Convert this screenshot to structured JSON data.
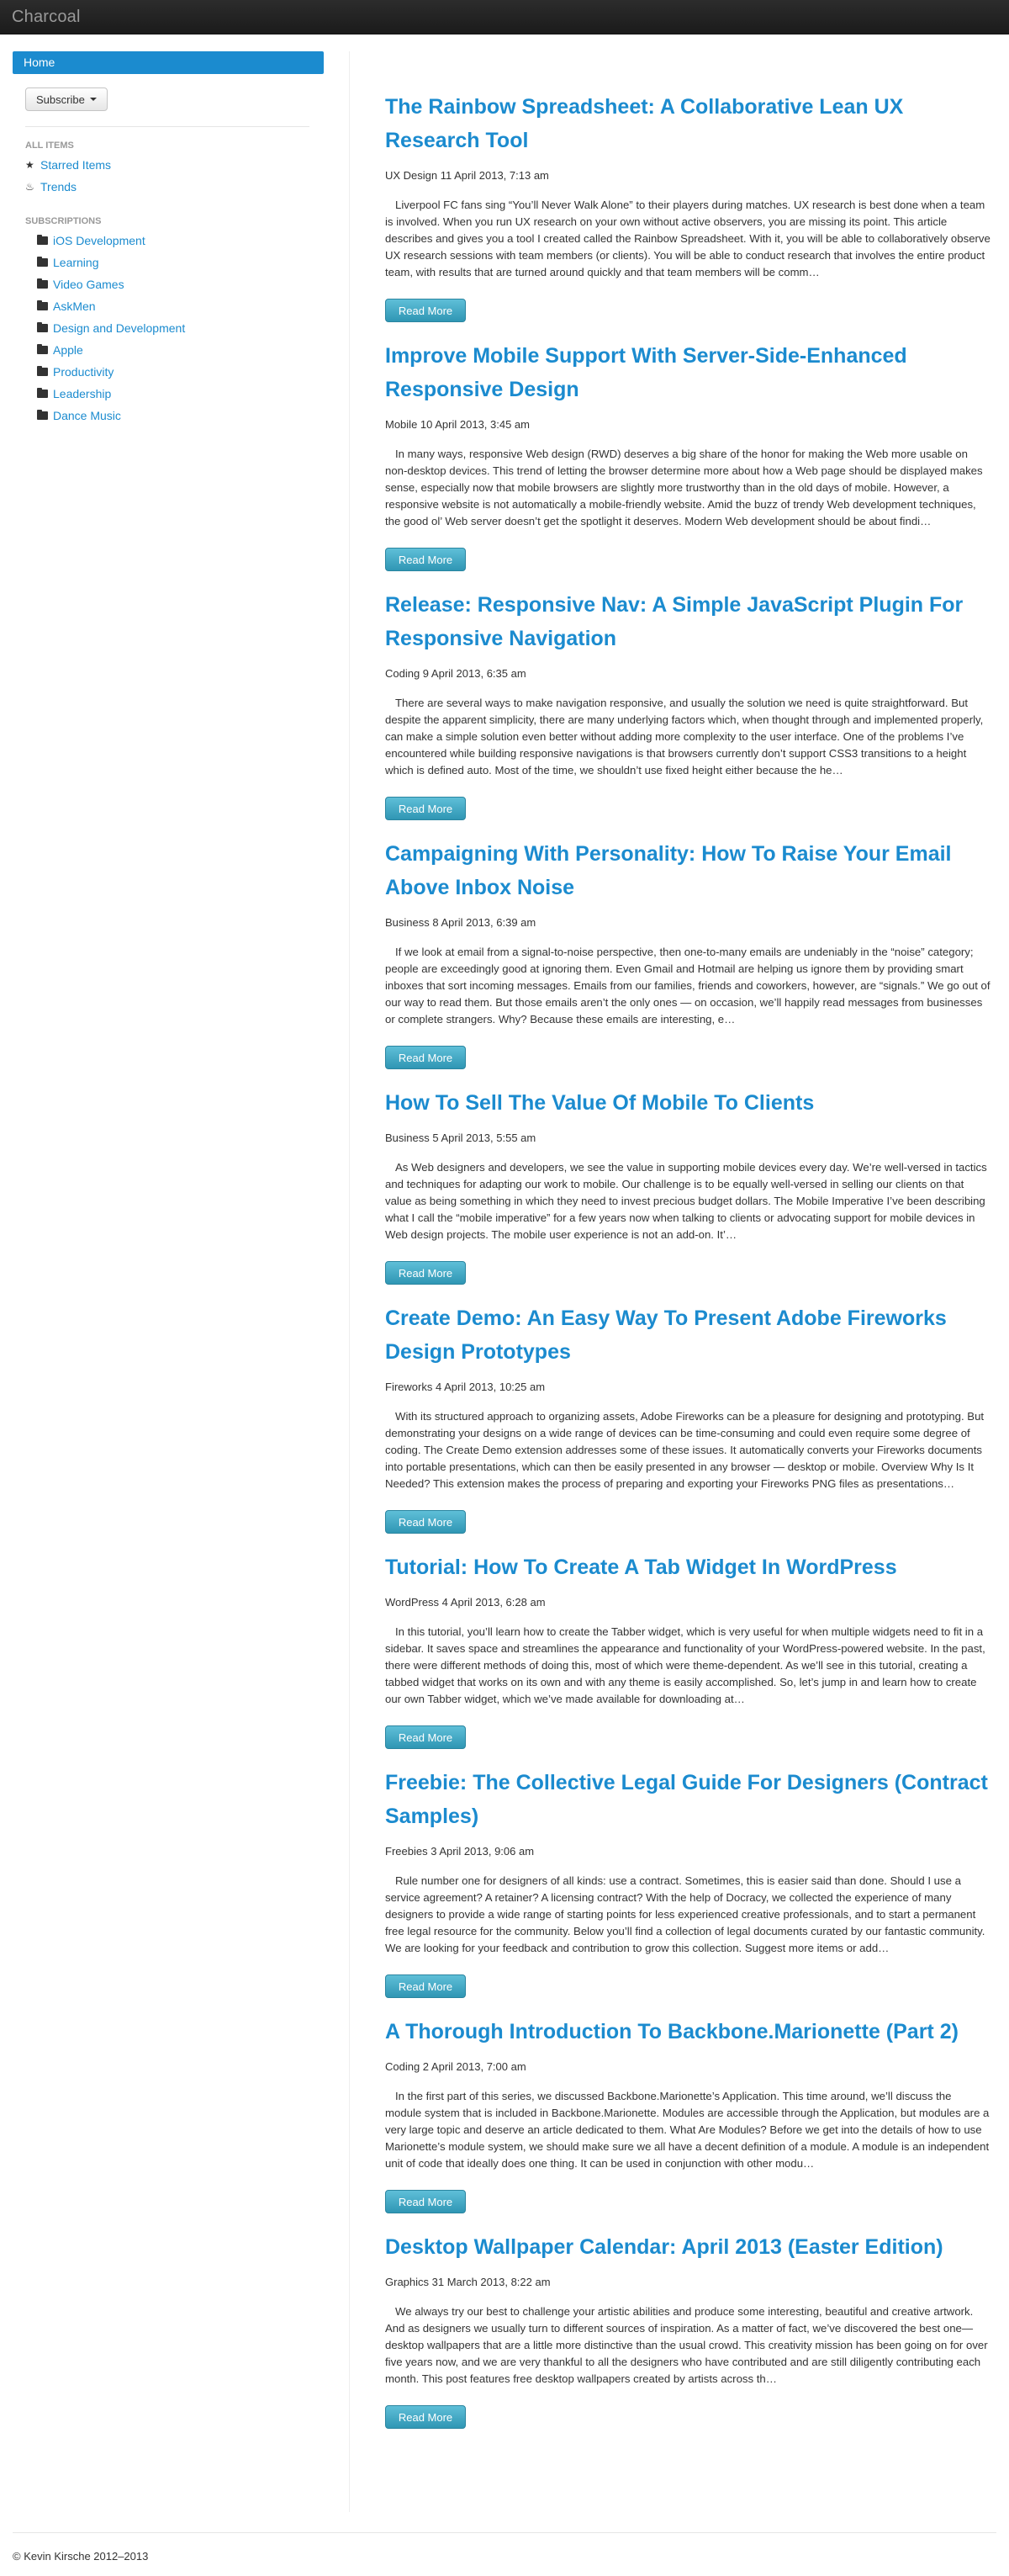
{
  "navbar": {
    "brand": "Charcoal"
  },
  "sidebar": {
    "home_label": "Home",
    "subscribe_label": "Subscribe",
    "all_items_header": "ALL ITEMS",
    "all_items": [
      {
        "label": "Starred Items",
        "icon": "star-icon"
      },
      {
        "label": "Trends",
        "icon": "fire-icon"
      }
    ],
    "subscriptions_header": "SUBSCRIPTIONS",
    "subscriptions": [
      "iOS Development",
      "Learning",
      "Video Games",
      "AskMen",
      "Design and Development",
      "Apple",
      "Productivity",
      "Leadership",
      "Dance Music"
    ]
  },
  "read_more_label": "Read More",
  "articles": [
    {
      "title": "The Rainbow Spreadsheet: A Collaborative Lean UX Research Tool",
      "meta": "UX Design 11 April 2013, 7:13 am",
      "excerpt": "Liverpool FC fans sing “You’ll Never Walk Alone” to their players during matches. UX research is best done when a team is involved. When you run UX research on your own without active observers, you are missing its point. This article describes and gives you a tool I created called the Rainbow Spreadsheet. With it, you will be able to collaboratively observe UX research sessions with team members (or clients). You will be able to conduct research that involves the entire product team, with results that are turned around quickly and that team members will be comm…"
    },
    {
      "title": "Improve Mobile Support With Server-Side-Enhanced Responsive Design",
      "meta": "Mobile 10 April 2013, 3:45 am",
      "excerpt": "In many ways, responsive Web design (RWD) deserves a big share of the honor for making the Web more usable on non-desktop devices. This trend of letting the browser determine more about how a Web page should be displayed makes sense, especially now that mobile browsers are slightly more trustworthy than in the old days of mobile. However, a responsive website is not automatically a mobile-friendly website. Amid the buzz of trendy Web development techniques, the good ol’ Web server doesn’t get the spotlight it deserves. Modern Web development should be about findi…"
    },
    {
      "title": "Release: Responsive Nav: A Simple JavaScript Plugin For Responsive Navigation",
      "meta": "Coding 9 April 2013, 6:35 am",
      "excerpt": "There are several ways to make navigation responsive, and usually the solution we need is quite straightforward. But despite the apparent simplicity, there are many underlying factors which, when thought through and implemented properly, can make a simple solution even better without adding more complexity to the user interface. One of the problems I’ve encountered while building responsive navigations is that browsers currently don’t support CSS3 transitions to a height which is defined auto. Most of the time, we shouldn’t use fixed height either because the he…"
    },
    {
      "title": "Campaigning With Personality: How To Raise Your Email Above Inbox Noise",
      "meta": "Business 8 April 2013, 6:39 am",
      "excerpt": "If we look at email from a signal-to-noise perspective, then one-to-many emails are undeniably in the “noise” category; people are exceedingly good at ignoring them. Even Gmail and Hotmail are helping us ignore them by providing smart inboxes that sort incoming messages. Emails from our families, friends and coworkers, however, are “signals.” We go out of our way to read them. But those emails aren’t the only ones — on occasion, we’ll happily read messages from businesses or complete strangers. Why? Because these emails are interesting, e…"
    },
    {
      "title": "How To Sell The Value Of Mobile To Clients",
      "meta": "Business 5 April 2013, 5:55 am",
      "excerpt": "As Web designers and developers, we see the value in supporting mobile devices every day. We’re well-versed in tactics and techniques for adapting our work to mobile. Our challenge is to be equally well-versed in selling our clients on that value as being something in which they need to invest precious budget dollars. The Mobile Imperative I’ve been describing what I call the “mobile imperative” for a few years now when talking to clients or advocating support for mobile devices in Web design projects. The mobile user experience is not an add-on. It’…"
    },
    {
      "title": "Create Demo: An Easy Way To Present Adobe Fireworks Design Prototypes",
      "meta": "Fireworks 4 April 2013, 10:25 am",
      "excerpt": "With its structured approach to organizing assets, Adobe Fireworks can be a pleasure for designing and prototyping. But demonstrating your designs on a wide range of devices can be time-consuming and could even require some degree of coding. The Create Demo extension addresses some of these issues. It automatically converts your Fireworks documents into portable presentations, which can then be easily presented in any browser — desktop or mobile. Overview Why Is It Needed? This extension makes the process of preparing and exporting your Fireworks PNG files as presentations…"
    },
    {
      "title": "Tutorial: How To Create A Tab Widget In WordPress",
      "meta": "WordPress 4 April 2013, 6:28 am",
      "excerpt": "In this tutorial, you’ll learn how to create the Tabber widget, which is very useful for when multiple widgets need to fit in a sidebar. It saves space and streamlines the appearance and functionality of your WordPress-powered website. In the past, there were different methods of doing this, most of which were theme-dependent. As we’ll see in this tutorial, creating a tabbed widget that works on its own and with any theme is easily accomplished. So, let’s jump in and learn how to create our own Tabber widget, which we’ve made available for downloading at…"
    },
    {
      "title": "Freebie: The Collective Legal Guide For Designers (Contract Samples)",
      "meta": "Freebies 3 April 2013, 9:06 am",
      "excerpt": "Rule number one for designers of all kinds: use a contract. Sometimes, this is easier said than done. Should I use a service agreement? A retainer? A licensing contract? With the help of Docracy, we collected the experience of many designers to provide a wide range of starting points for less experienced creative professionals, and to start a permanent free legal resource for the community. Below you’ll find a collection of legal documents curated by our fantastic community. We are looking for your feedback and contribution to grow this collection. Suggest more items or add…"
    },
    {
      "title": "A Thorough Introduction To Backbone.Marionette (Part 2)",
      "meta": "Coding 2 April 2013, 7:00 am",
      "excerpt": "In the first part of this series, we discussed Backbone.Marionette’s Application. This time around, we’ll discuss the module system that is included in Backbone.Marionette. Modules are accessible through the Application, but modules are a very large topic and deserve an article dedicated to them. What Are Modules? Before we get into the details of how to use Marionette’s module system, we should make sure we all have a decent definition of a module. A module is an independent unit of code that ideally does one thing. It can be used in conjunction with other modu…"
    },
    {
      "title": "Desktop Wallpaper Calendar: April 2013 (Easter Edition)",
      "meta": "Graphics 31 March 2013, 8:22 am",
      "excerpt": "We always try our best to challenge your artistic abilities and produce some interesting, beautiful and creative artwork. And as designers we usually turn to different sources of inspiration. As a matter of fact, we’ve discovered the best one—desktop wallpapers that are a little more distinctive than the usual crowd. This creativity mission has been going on for over five years now, and we are very thankful to all the designers who have contributed and are still diligently contributing each month. This post features free desktop wallpapers created by artists across th…"
    }
  ],
  "footer": {
    "text": "© Kevin Kirsche 2012–2013"
  },
  "colors": {
    "link": "#1b8bcf",
    "navbar": "#1b1b1b",
    "button": "#2f96b4"
  }
}
